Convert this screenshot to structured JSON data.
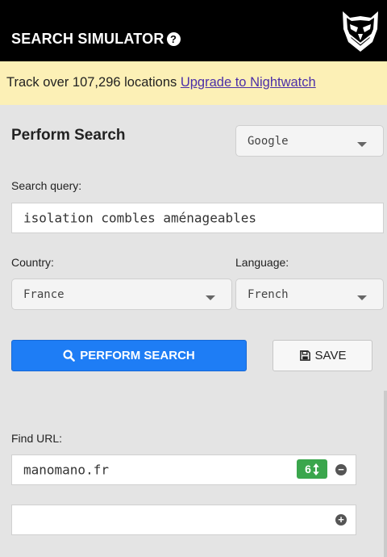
{
  "header": {
    "title": "SEARCH SIMULATOR",
    "help_icon": "?",
    "logo_icon": "owl-logo-icon",
    "background": "#000000"
  },
  "promo": {
    "text": "Track over 107,296 locations ",
    "link": "Upgrade to Nightwatch",
    "background": "#fcf0b6",
    "link_color": "#4b2fa8"
  },
  "form": {
    "section_title": "Perform Search",
    "engine": "Google",
    "query_label": "Search query:",
    "query_value": "isolation combles aménageables",
    "country_label": "Country:",
    "country_value": "France",
    "language_label": "Language:",
    "language_value": "French"
  },
  "actions": {
    "perform_label": "PERFORM SEARCH",
    "perform_icon": "search-icon",
    "save_label": "SAVE",
    "save_icon": "floppy-disk-icon",
    "accent": "#1e7df5"
  },
  "find_url": {
    "label": "Find URL:",
    "url_value": "manomano.fr",
    "rank": "6",
    "rank_icon": "sort-arrows-icon",
    "rank_color": "#3aa64c",
    "remove_icon": "minus-circle-icon",
    "new_url_value": "",
    "add_icon": "plus-circle-icon"
  }
}
